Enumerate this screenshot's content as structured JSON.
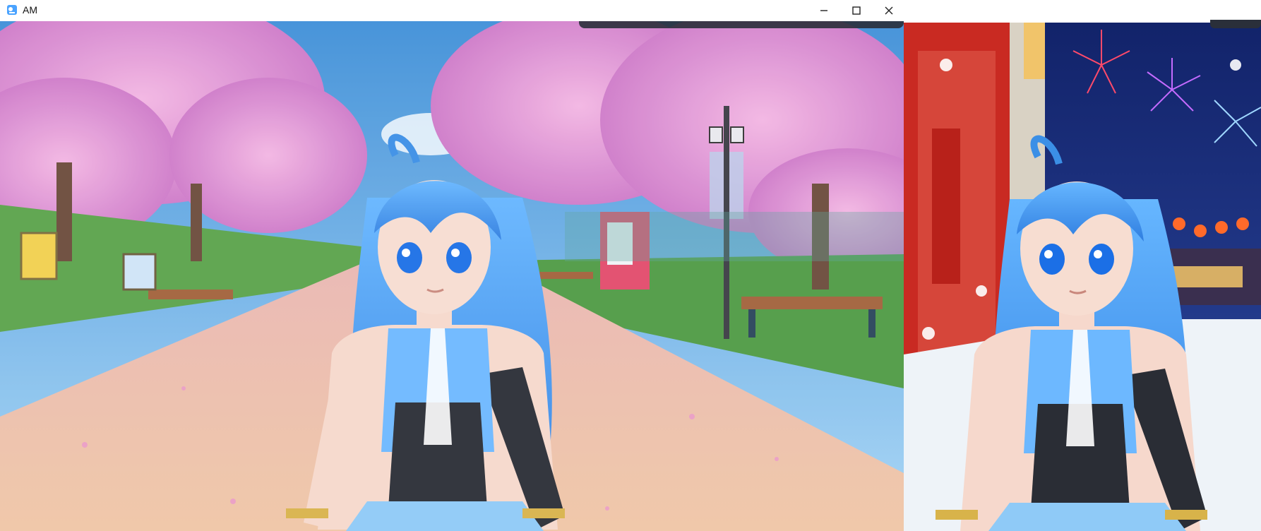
{
  "window": {
    "title": "AM",
    "controls": {
      "minimize": "minimize-icon",
      "maximize": "maximize-icon",
      "close": "close-icon"
    }
  },
  "colors": {
    "sky": "#5aa8e8",
    "blossom": "#e7a2d8",
    "path": "#f4c8a8",
    "grass": "#5aa34a",
    "hair": "#3b8fe6",
    "outfit_black": "#2a2d35",
    "night_sky": "#1a2a66",
    "red_door": "#d2342b",
    "snow": "#eef3f8"
  }
}
